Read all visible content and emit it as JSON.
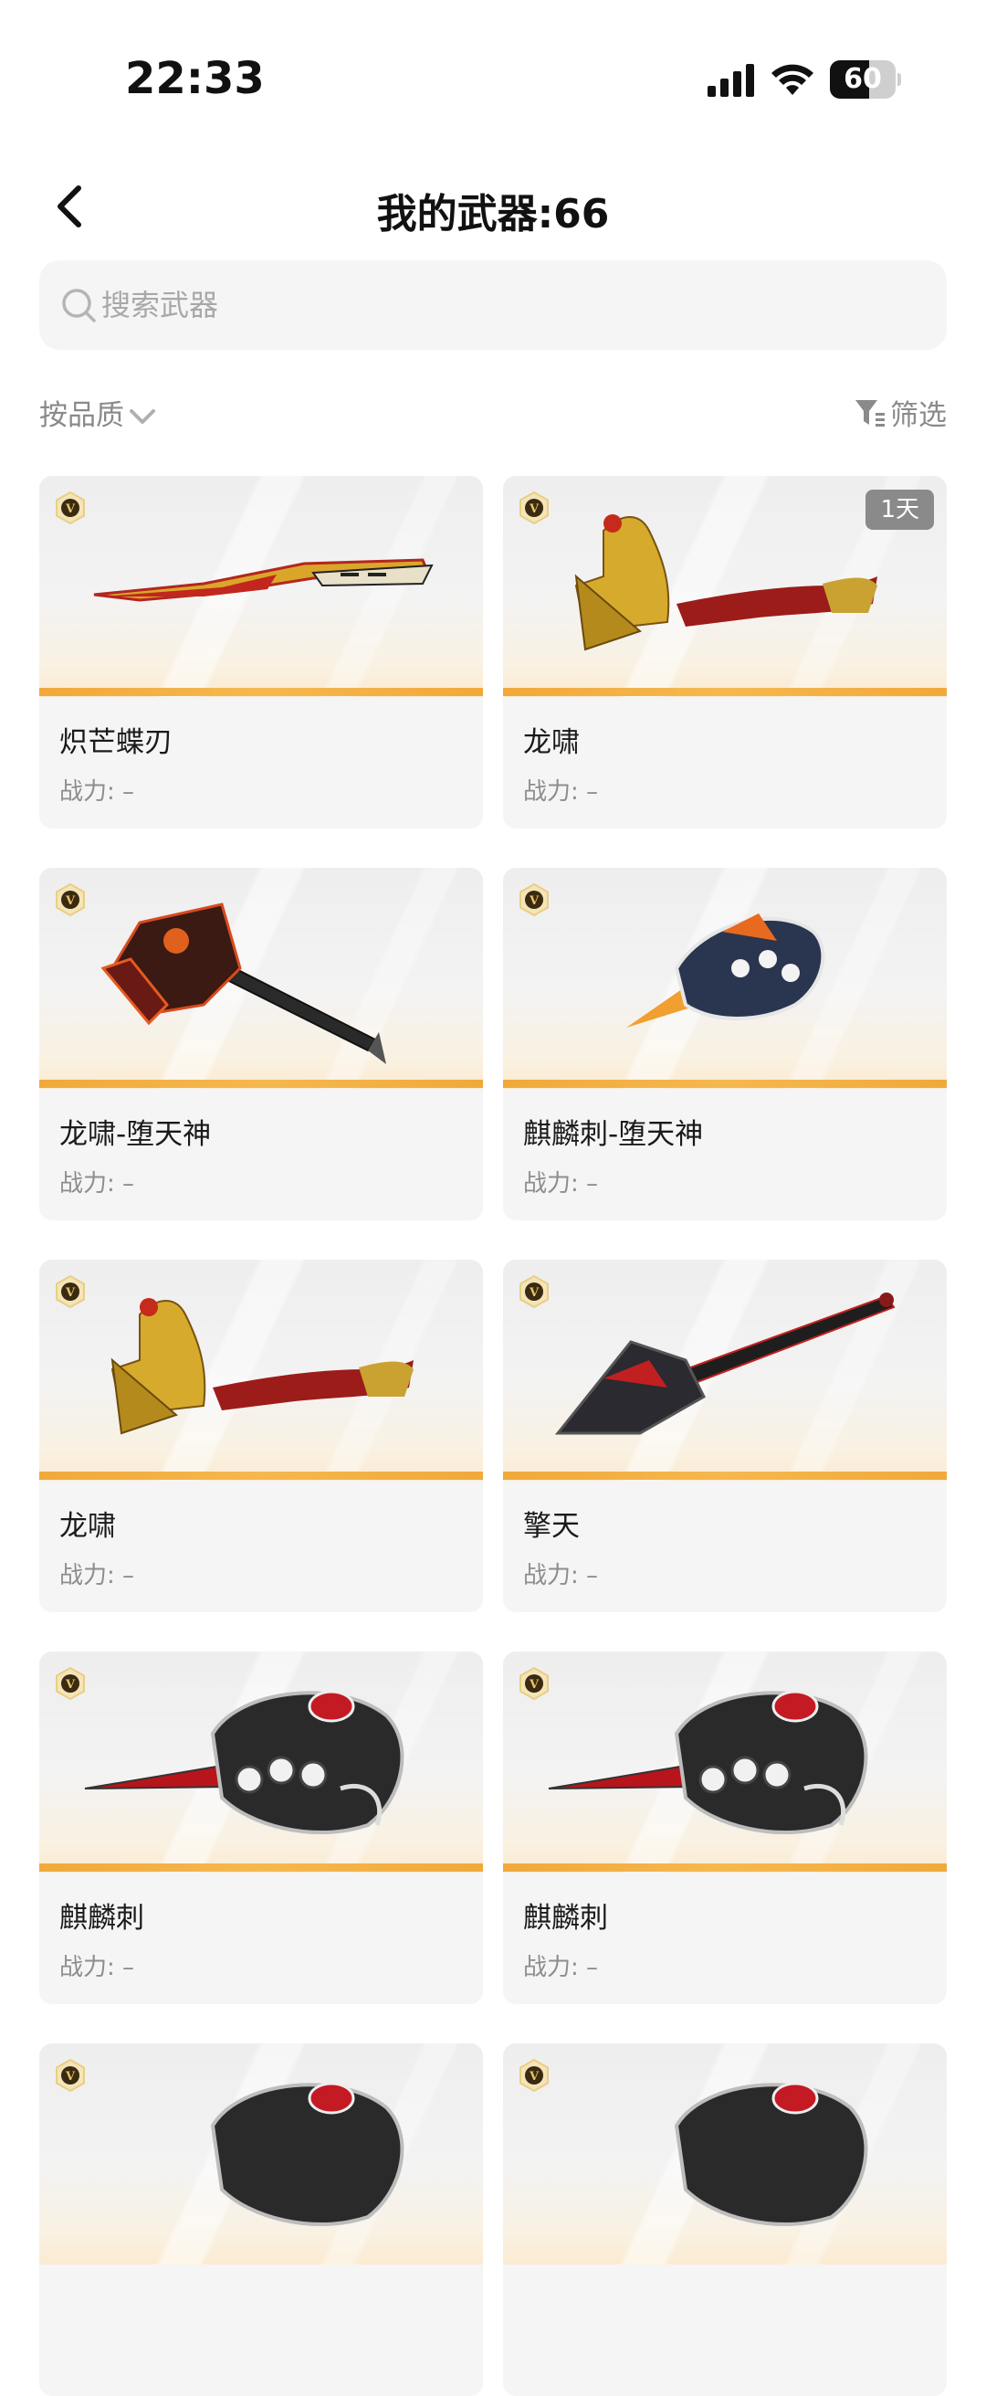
{
  "status_bar": {
    "time": "22:33",
    "battery": "60",
    "battery_level": 0.6
  },
  "header": {
    "title": "我的武器:66"
  },
  "search": {
    "placeholder": "搜索武器"
  },
  "filters": {
    "sort_label": "按品质",
    "filter_label": "筛选"
  },
  "power_prefix": "战力: –",
  "colors": {
    "quality_bar": "#f0a93b",
    "badge_gold": "#c9a24b",
    "tag_gray": "#8a8a8a",
    "card_bg": "#f5f5f5"
  },
  "weapons": [
    {
      "name": "炽芒蝶刃",
      "power": "战力: –",
      "tag": "",
      "icon": "butterfly-knife"
    },
    {
      "name": "龙啸",
      "power": "战力: –",
      "tag": "1天",
      "icon": "dragon-axe"
    },
    {
      "name": "龙啸-堕天神",
      "power": "战力: –",
      "tag": "",
      "icon": "dark-axe"
    },
    {
      "name": "麒麟刺-堕天神",
      "power": "战力: –",
      "tag": "",
      "icon": "dark-knuckle"
    },
    {
      "name": "龙啸",
      "power": "战力: –",
      "tag": "",
      "icon": "dragon-axe"
    },
    {
      "name": "擎天",
      "power": "战力: –",
      "tag": "",
      "icon": "shovel"
    },
    {
      "name": "麒麟刺",
      "power": "战力: –",
      "tag": "",
      "icon": "knuckle"
    },
    {
      "name": "麒麟刺",
      "power": "战力: –",
      "tag": "",
      "icon": "knuckle"
    },
    {
      "name": "",
      "power": "",
      "tag": "",
      "icon": "knuckle"
    },
    {
      "name": "",
      "power": "",
      "tag": "",
      "icon": "knuckle"
    }
  ]
}
